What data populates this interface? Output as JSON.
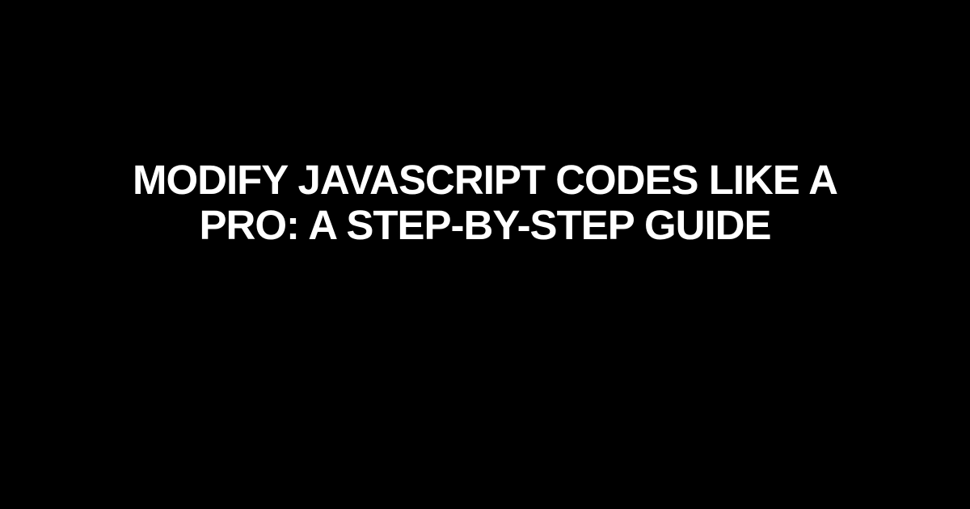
{
  "title": "Modify JavaScript Codes Like a Pro: A Step-by-Step Guide"
}
